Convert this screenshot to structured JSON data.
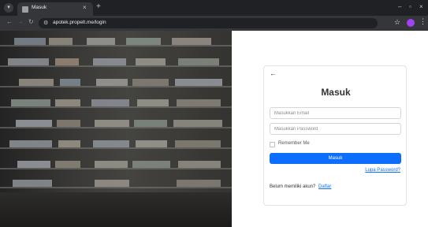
{
  "browser": {
    "tab_title": "Masuk",
    "tab_close": "×",
    "new_tab": "+",
    "url": "apotek.propelt.me/login",
    "window_controls": {
      "minimize": "–",
      "maximize": "▫",
      "close": "×"
    },
    "icons": [
      "tab-menu-icon",
      "favicon-icon",
      "back-icon",
      "forward-icon",
      "reload-icon",
      "site-info-icon",
      "star-icon",
      "profile-avatar",
      "more-menu-icon"
    ],
    "profile_color": "#a142f4"
  },
  "hero": {
    "description_icon": "pharmacy-shelves-image"
  },
  "login": {
    "back_icon": "←",
    "title": "Masuk",
    "email_placeholder": "Masukkan Email",
    "password_placeholder": "Masukkan Password",
    "remember_label": "Remember Me",
    "submit_label": "Masuk",
    "forgot_label": "Lupa Password?",
    "register_prompt": "Belum memiliki akun?",
    "register_link": "Daftar",
    "accent_color": "#0d6efd"
  }
}
